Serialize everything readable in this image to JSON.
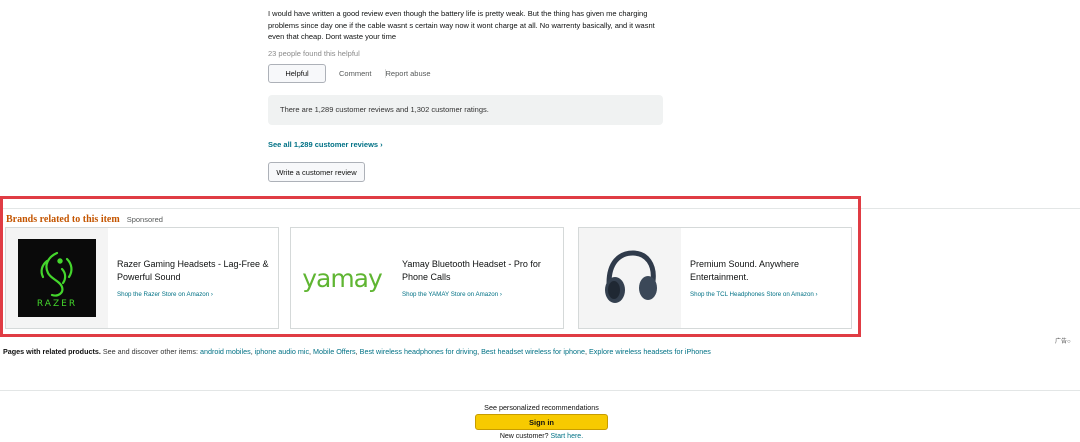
{
  "review": {
    "text": "I would have written a good review even though the battery life is pretty weak. But the thing has given me charging problems since day one if the cable wasnt s certain way now it wont charge at all. No warrenty basically, and it wasnt even that cheap. Dont waste your time",
    "helpful_count": "23 people found this helpful",
    "helpful_label": "Helpful",
    "comment_label": "Comment",
    "report_label": "Report abuse"
  },
  "summary": {
    "counts_text": "There are 1,289 customer reviews and 1,302 customer ratings.",
    "see_all_label": "See all 1,289 customer reviews ›",
    "write_review_label": "Write a customer review"
  },
  "brands": {
    "title": "Brands related to this item",
    "sponsored": "Sponsored",
    "cards": [
      {
        "headline": "Razer Gaming Headsets - Lag-Free & Powerful Sound",
        "link": "Shop the Razer Store on Amazon ›",
        "logo_text": "RAZER",
        "logo_color": "#44d62c"
      },
      {
        "headline": "Yamay Bluetooth Headset - Pro for Phone Calls",
        "link": "Shop the YAMAY Store on Amazon ›",
        "logo_text": "yamay",
        "logo_color": "#5fb532"
      },
      {
        "headline": "Premium Sound. Anywhere Entertainment.",
        "link": "Shop the TCL Headphones Store on Amazon ›",
        "image": "headphones"
      }
    ]
  },
  "ad_label": "广告",
  "related": {
    "heading": "Pages with related products.",
    "intro": "See and discover other items:",
    "links": [
      "android mobiles",
      "iphone audio mic",
      "Mobile Offers",
      "Best wireless headphones for driving",
      "Best headset wireless for iphone",
      "Explore wireless headsets for iPhones"
    ]
  },
  "footer": {
    "personalized": "See personalized recommendations",
    "signin_label": "Sign in",
    "new_customer": "New customer?",
    "start_here": "Start here."
  },
  "colors": {
    "accent_link": "#007185",
    "brand_title": "#c45500",
    "highlight_border": "#e03c44",
    "signin_button": "#f7ca00"
  }
}
